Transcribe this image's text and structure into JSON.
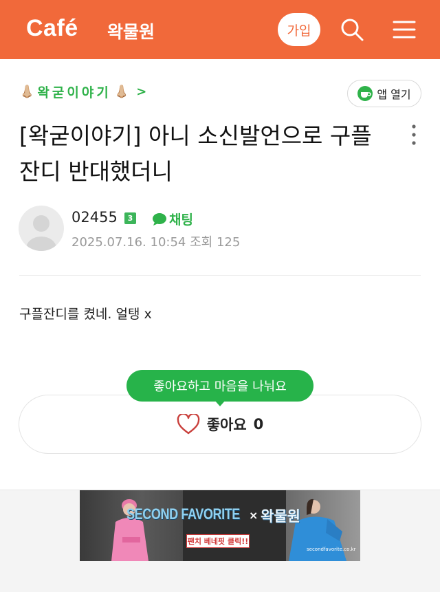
{
  "header": {
    "logo": "Café",
    "cafe_name": "왁물원",
    "join_label": "가입",
    "background_color": "#f1693a",
    "icons": [
      "search-icon",
      "menu-icon"
    ]
  },
  "breadcrumb": {
    "emoji_left": "👃🏼",
    "label": "왁굳이야기",
    "emoji_right": "👃🏼",
    "arrow": ">"
  },
  "app_open": {
    "label": "앱 열기",
    "icon": "coffee-cup-icon"
  },
  "post": {
    "title": "[왁굳이야기] 아니 소신발언으로 구플잔디 반대했더니",
    "author": "02455",
    "level": "3",
    "chat_label": "채팅",
    "meta": "2025.07.16. 10:54 조회 125",
    "body": "구플잔디를 켰네. 얼탱 x"
  },
  "like": {
    "tooltip": "좋아요하고 마음을 나눠요",
    "label": "좋아요",
    "count": "0",
    "accent": "#27b34a"
  },
  "ad": {
    "brand": "SECOND FAVORITE",
    "x": "×",
    "partner": "왁물원",
    "cta": "팬치 베네핏 클릭!!",
    "url": "secondfavorite.co.kr"
  }
}
